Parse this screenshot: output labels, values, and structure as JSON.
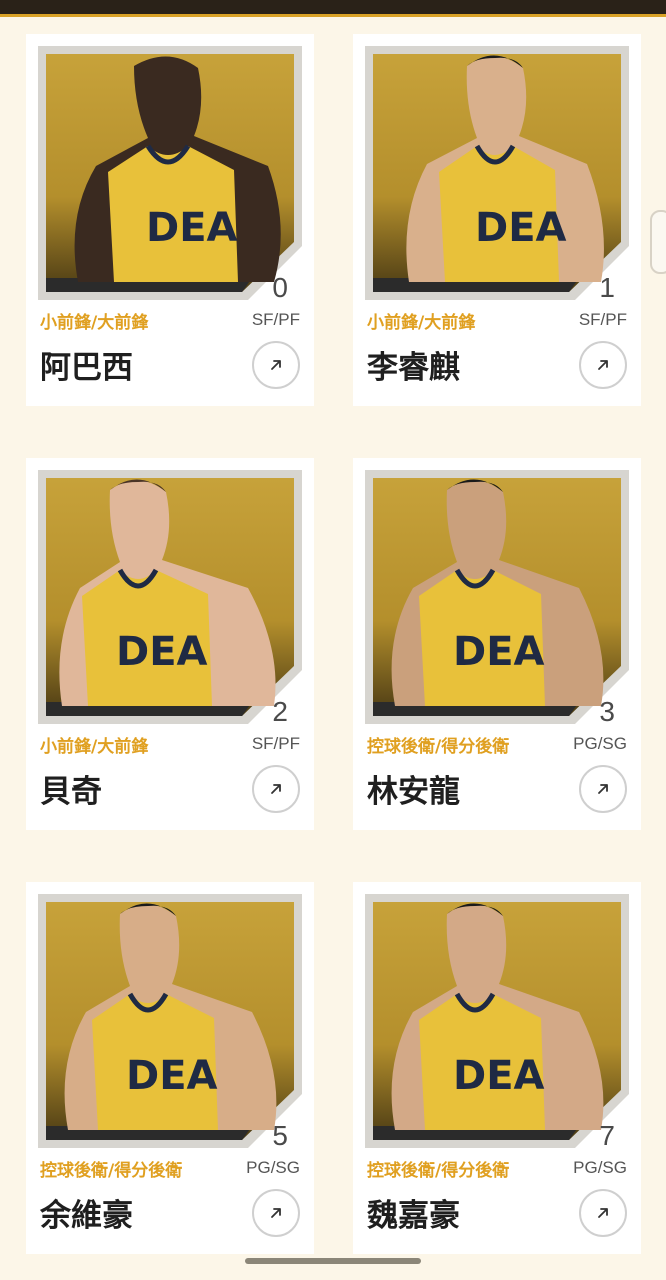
{
  "colors": {
    "background": "#fcf6e8",
    "accent": "#e0a021",
    "card": "#ffffff",
    "jersey": "#e8c13a"
  },
  "players": [
    {
      "number": "0",
      "position_cn": "小前鋒/大前鋒",
      "position_en": "SF/PF",
      "name": "阿巴西"
    },
    {
      "number": "1",
      "position_cn": "小前鋒/大前鋒",
      "position_en": "SF/PF",
      "name": "李睿麒"
    },
    {
      "number": "2",
      "position_cn": "小前鋒/大前鋒",
      "position_en": "SF/PF",
      "name": "貝奇"
    },
    {
      "number": "3",
      "position_cn": "控球後衛/得分後衛",
      "position_en": "PG/SG",
      "name": "林安龍"
    },
    {
      "number": "5",
      "position_cn": "控球後衛/得分後衛",
      "position_en": "PG/SG",
      "name": "余維豪"
    },
    {
      "number": "7",
      "position_cn": "控球後衛/得分後衛",
      "position_en": "PG/SG",
      "name": "魏嘉豪"
    }
  ],
  "icons": {
    "details_button": "arrow-up-right-icon",
    "photo": "player-photo"
  }
}
